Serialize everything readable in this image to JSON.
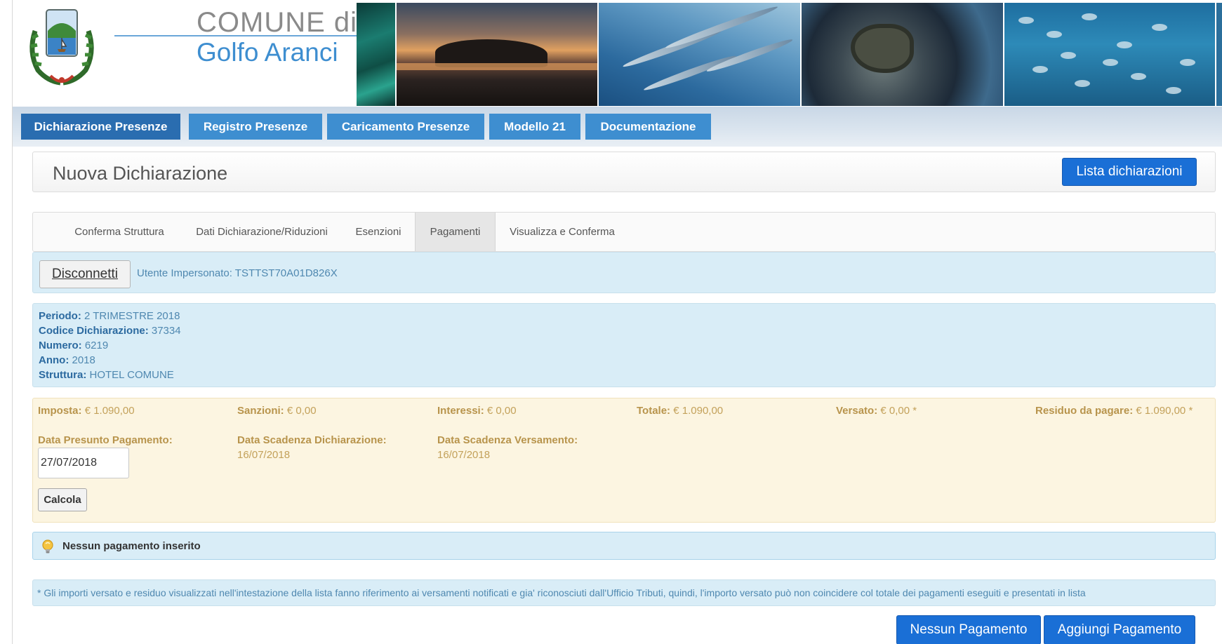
{
  "header": {
    "brand_top": "COMUNE di",
    "brand_bottom": "Golfo Aranci"
  },
  "nav": {
    "tabs": [
      {
        "label": "Dichiarazione Presenze"
      },
      {
        "label": "Registro Presenze"
      },
      {
        "label": "Caricamento Presenze"
      },
      {
        "label": "Modello 21"
      },
      {
        "label": "Documentazione"
      }
    ],
    "active_index": 0
  },
  "title_panel": {
    "title": "Nuova Dichiarazione",
    "list_button": "Lista dichiarazioni"
  },
  "steps": {
    "items": [
      {
        "label": "Conferma Struttura"
      },
      {
        "label": "Dati Dichiarazione/Riduzioni"
      },
      {
        "label": "Esenzioni"
      },
      {
        "label": "Pagamenti"
      },
      {
        "label": "Visualizza e Conferma"
      }
    ],
    "active_index": 3
  },
  "impersonation": {
    "disconnect_button": "Disconnetti",
    "text": "Utente Impersonato: TSTTST70A01D826X"
  },
  "declaration": {
    "periodo_label": "Periodo:",
    "periodo": "2 TRIMESTRE 2018",
    "codice_label": "Codice Dichiarazione:",
    "codice": "37334",
    "numero_label": "Numero:",
    "numero": "6219",
    "anno_label": "Anno:",
    "anno": "2018",
    "struttura_label": "Struttura:",
    "struttura": "HOTEL COMUNE"
  },
  "payments": {
    "imposta_label": "Imposta:",
    "imposta": "€ 1.090,00",
    "sanzioni_label": "Sanzioni:",
    "sanzioni": "€ 0,00",
    "interessi_label": "Interessi:",
    "interessi": "€ 0,00",
    "totale_label": "Totale:",
    "totale": "€ 1.090,00",
    "versato_label": "Versato:",
    "versato": "€ 0,00 *",
    "residuo_label": "Residuo da pagare:",
    "residuo": "€ 1.090,00 *",
    "data_presunto_label": "Data Presunto Pagamento:",
    "data_presunto_value": "27/07/2018",
    "scadenza_dich_label": "Data Scadenza Dichiarazione:",
    "scadenza_dich_value": "16/07/2018",
    "scadenza_vers_label": "Data Scadenza Versamento:",
    "scadenza_vers_value": "16/07/2018",
    "calcola_button": "Calcola"
  },
  "empty_notice": {
    "text": "Nessun pagamento inserito",
    "icon": "lightbulb-icon"
  },
  "footnote": {
    "text": "* Gli importi versato e residuo visualizzati nell'intestazione della lista fanno riferimento ai versamenti notificati e gia' riconosciuti dall'Ufficio Tributi, quindi, l'importo versato può non coincidere col totale dei pagamenti eseguiti e presentati in lista"
  },
  "actions": {
    "none_button": "Nessun Pagamento",
    "add_button": "Aggiungi Pagamento"
  },
  "colors": {
    "nav_tab": "#3e8ed0",
    "nav_tab_active": "#2a6db0",
    "primary_button": "#1a6fd6",
    "info_bg": "#d9edf7",
    "warning_bg": "#fcf5e1"
  }
}
